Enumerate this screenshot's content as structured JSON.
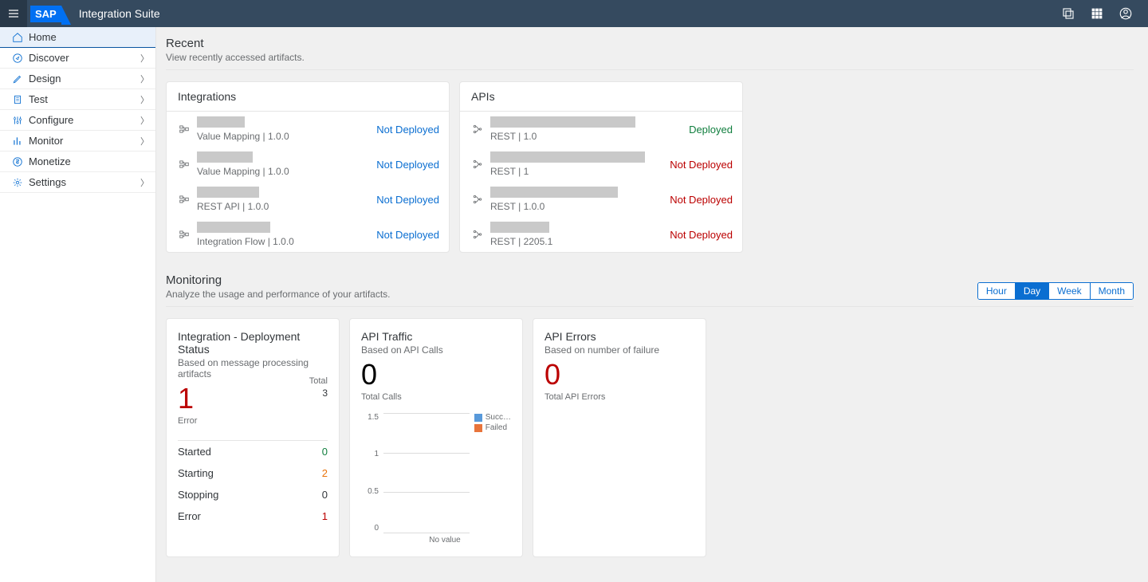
{
  "shell": {
    "app_title": "Integration Suite",
    "logo_text": "SAP"
  },
  "sidebar": {
    "items": [
      {
        "label": "Home",
        "active": true,
        "expandable": false
      },
      {
        "label": "Discover",
        "active": false,
        "expandable": true
      },
      {
        "label": "Design",
        "active": false,
        "expandable": true
      },
      {
        "label": "Test",
        "active": false,
        "expandable": true
      },
      {
        "label": "Configure",
        "active": false,
        "expandable": true
      },
      {
        "label": "Monitor",
        "active": false,
        "expandable": true
      },
      {
        "label": "Monetize",
        "active": false,
        "expandable": false
      },
      {
        "label": "Settings",
        "active": false,
        "expandable": true
      }
    ]
  },
  "recent": {
    "title": "Recent",
    "subtitle": "View recently accessed artifacts."
  },
  "integrations_panel": {
    "title": "Integrations",
    "items": [
      {
        "meta": "Value Mapping  |  1.0.0",
        "status": "Not Deployed",
        "status_class": "status-blue",
        "name_w": 60
      },
      {
        "meta": "Value Mapping  |  1.0.0",
        "status": "Not Deployed",
        "status_class": "status-blue",
        "name_w": 70
      },
      {
        "meta": "REST API  |  1.0.0",
        "status": "Not Deployed",
        "status_class": "status-blue",
        "name_w": 78
      },
      {
        "meta": "Integration Flow  |  1.0.0",
        "status": "Not Deployed",
        "status_class": "status-blue",
        "name_w": 92
      }
    ]
  },
  "apis_panel": {
    "title": "APIs",
    "items": [
      {
        "meta": "REST  |  1.0",
        "status": "Deployed",
        "status_class": "status-dep",
        "name_w": 182
      },
      {
        "meta": "REST  |  1",
        "status": "Not Deployed",
        "status_class": "status-not",
        "name_w": 194
      },
      {
        "meta": "REST  |  1.0.0",
        "status": "Not Deployed",
        "status_class": "status-not",
        "name_w": 160
      },
      {
        "meta": "REST  |  2205.1",
        "status": "Not Deployed",
        "status_class": "status-not",
        "name_w": 74
      }
    ]
  },
  "monitoring": {
    "title": "Monitoring",
    "subtitle": "Analyze the usage and performance of your artifacts.",
    "seg": [
      "Hour",
      "Day",
      "Week",
      "Month"
    ],
    "seg_active": "Day"
  },
  "deploy_card": {
    "title": "Integration - Deployment Status",
    "sub": "Based on message processing artifacts",
    "big": "1",
    "big_label": "Error",
    "total_label": "Total",
    "total_value": "3",
    "rows": [
      {
        "label": "Started",
        "value": "0",
        "cls": "green"
      },
      {
        "label": "Starting",
        "value": "2",
        "cls": "orange"
      },
      {
        "label": "Stopping",
        "value": "0",
        "cls": "gray"
      },
      {
        "label": "Error",
        "value": "1",
        "cls": "red"
      }
    ]
  },
  "traffic_card": {
    "title": "API Traffic",
    "sub": "Based on API Calls",
    "big": "0",
    "big_label": "Total Calls",
    "legend": {
      "success": "Succ…",
      "failed": "Failed"
    },
    "xlabel": "No value",
    "ticks": [
      "1.5",
      "1",
      "0.5",
      "0"
    ]
  },
  "errors_card": {
    "title": "API Errors",
    "sub": "Based on number of failure",
    "big": "0",
    "big_label": "Total API Errors"
  },
  "chart_data": {
    "type": "bar",
    "title": "API Traffic",
    "xlabel": "No value",
    "ylabel": "",
    "ylim": [
      0,
      1.5
    ],
    "yticks": [
      0,
      0.5,
      1,
      1.5
    ],
    "categories": [],
    "series": [
      {
        "name": "Success",
        "values": []
      },
      {
        "name": "Failed",
        "values": []
      }
    ]
  }
}
